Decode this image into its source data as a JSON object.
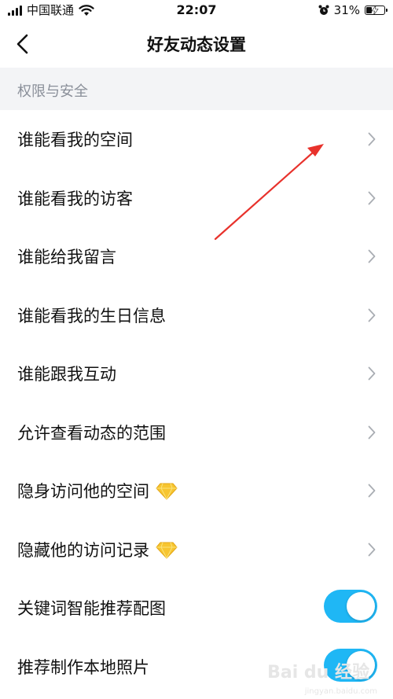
{
  "status_bar": {
    "carrier": "中国联通",
    "time": "22:07",
    "battery": "31%",
    "battery_level": 0.31
  },
  "nav": {
    "back_icon": "chevron-left-icon",
    "title": "好友动态设置"
  },
  "section": {
    "title": "权限与安全"
  },
  "rows": [
    {
      "label": "谁能看我的空间",
      "control": "chevron"
    },
    {
      "label": "谁能看我的访客",
      "control": "chevron"
    },
    {
      "label": "谁能给我留言",
      "control": "chevron"
    },
    {
      "label": "谁能看我的生日信息",
      "control": "chevron"
    },
    {
      "label": "谁能跟我互动",
      "control": "chevron"
    },
    {
      "label": "允许查看动态的范围",
      "control": "chevron"
    },
    {
      "label": "隐身访问他的空间",
      "control": "chevron",
      "icon": "diamond-icon"
    },
    {
      "label": "隐藏他的访问记录",
      "control": "chevron",
      "icon": "diamond-icon"
    },
    {
      "label": "关键词智能推荐配图",
      "control": "toggle",
      "on": true
    },
    {
      "label": "推荐制作本地照片",
      "control": "toggle",
      "on": true
    }
  ],
  "colors": {
    "toggle_on": "#1fb7f5",
    "annotation_arrow": "#e8322c",
    "diamond": "#f7c530"
  },
  "watermark": {
    "brand": "Bai du 经验",
    "url": "jingyan.baidu.com"
  }
}
